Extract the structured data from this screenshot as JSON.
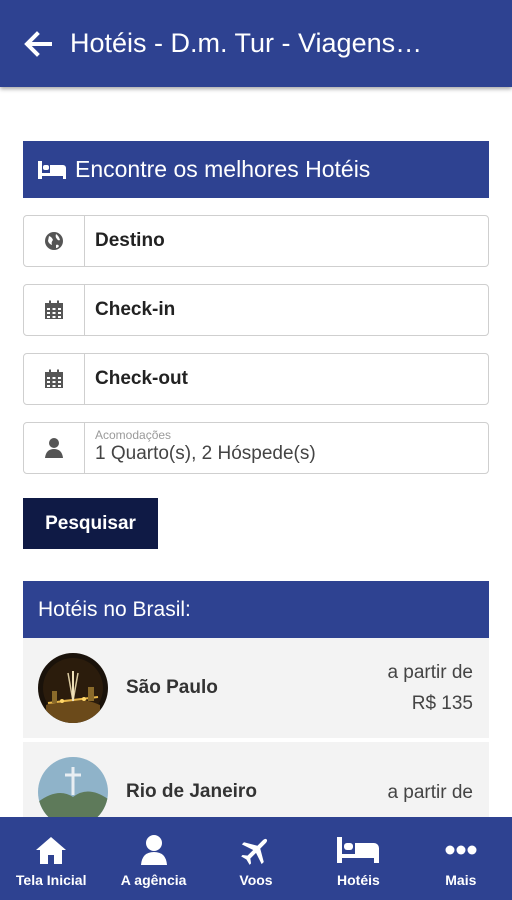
{
  "appbar": {
    "title": "Hotéis - D.m. Tur - Viagens…",
    "back_icon": "arrow-left-icon"
  },
  "search": {
    "header": "Encontre os melhores Hotéis",
    "destination_placeholder": "Destino",
    "checkin_placeholder": "Check-in",
    "checkout_placeholder": "Check-out",
    "accommodations_label": "Acomodações",
    "accommodations_value": "1 Quarto(s), 2 Hóspede(s)",
    "button_label": "Pesquisar"
  },
  "brasil": {
    "header": "Hotéis no Brasil:",
    "cities": [
      {
        "name": "São Paulo",
        "price_prefix": "a partir de",
        "price": "R$ 135"
      },
      {
        "name": "Rio de Janeiro",
        "price_prefix": "a partir de",
        "price": ""
      }
    ]
  },
  "bottom_nav": {
    "items": [
      {
        "label": "Tela Inicial",
        "icon": "home-icon"
      },
      {
        "label": "A agência",
        "icon": "user-icon"
      },
      {
        "label": "Voos",
        "icon": "airplane-icon"
      },
      {
        "label": "Hotéis",
        "icon": "bed-icon"
      },
      {
        "label": "Mais",
        "icon": "more-icon"
      }
    ]
  },
  "colors": {
    "primary": "#2e4291",
    "button_dark": "#0f1a45",
    "row_bg": "#f3f3f3"
  }
}
